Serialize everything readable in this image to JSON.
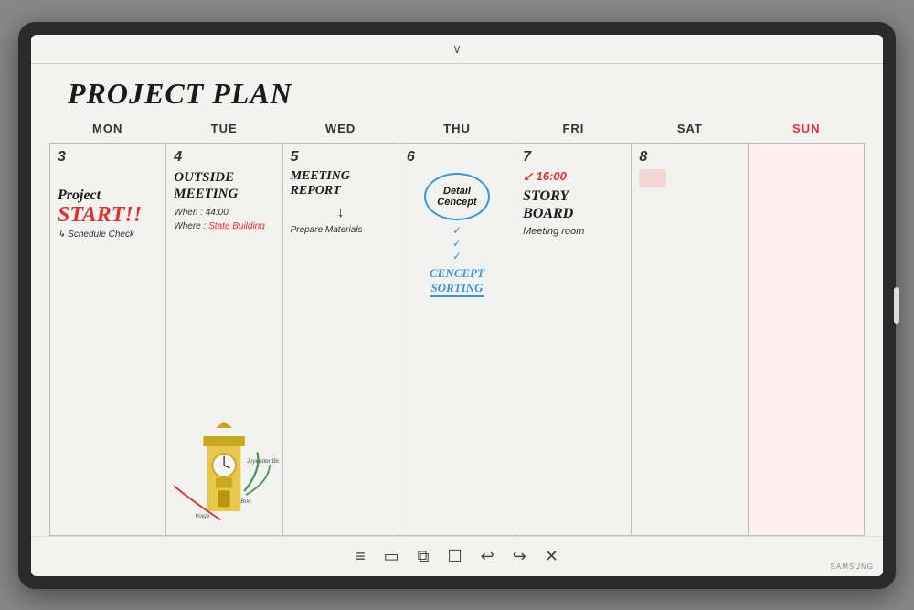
{
  "monitor": {
    "title": "Samsung Interactive Display"
  },
  "header": {
    "chevron": "∨",
    "title": "PROJECT PLAN"
  },
  "days": {
    "headers": [
      "MON",
      "TUE",
      "WED",
      "THU",
      "FRI",
      "SAT",
      "SUN"
    ],
    "numbers": [
      "3",
      "4",
      "5",
      "6",
      "7",
      "8",
      ""
    ]
  },
  "cells": {
    "mon": {
      "label": "Project",
      "start": "START!!",
      "schedule": "↳ Schedule Check"
    },
    "tue": {
      "title_line1": "OUTSIDE",
      "title_line2": "MEETING",
      "when": "When : 44:00",
      "where": "Where :",
      "location": "State Building",
      "arrow_note": "↗ Joyender Blor",
      "note2": "Bon",
      "note3": "Voige"
    },
    "wed": {
      "title_line1": "MEETING",
      "title_line2": "REPORT",
      "arrow": "→",
      "desc": "Prepare Materials"
    },
    "thu": {
      "bubble_line1": "Detail",
      "bubble_line2": "Cencept",
      "sorting_line1": "CENCEPT",
      "sorting_line2": "SORTING"
    },
    "fri": {
      "time": "↙ 16:00",
      "title_line1": "STORY",
      "title_line2": "BOARD",
      "room": "Meeting room"
    },
    "sat": {
      "note": ""
    },
    "sun": {
      "note": ""
    }
  },
  "toolbar": {
    "icons": [
      "≡",
      "▭",
      "⧉",
      "☐",
      "↩",
      "↪",
      "✕"
    ]
  },
  "branding": {
    "samsung": "SAMSUNG"
  }
}
